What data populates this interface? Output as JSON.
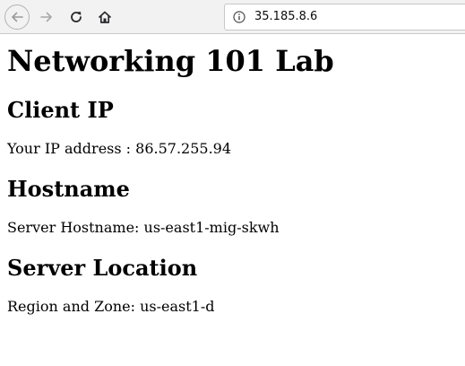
{
  "browser": {
    "url": "35.185.8.6",
    "icons": {
      "back": "back-arrow-icon",
      "forward": "forward-arrow-icon",
      "reload": "reload-icon",
      "home": "home-icon",
      "site_info": "info-icon"
    }
  },
  "page": {
    "title": "Networking 101 Lab",
    "sections": [
      {
        "heading": "Client IP",
        "text": "Your IP address : 86.57.255.94"
      },
      {
        "heading": "Hostname",
        "text": "Server Hostname: us-east1-mig-skwh"
      },
      {
        "heading": "Server Location",
        "text": "Region and Zone: us-east1-d"
      }
    ]
  }
}
